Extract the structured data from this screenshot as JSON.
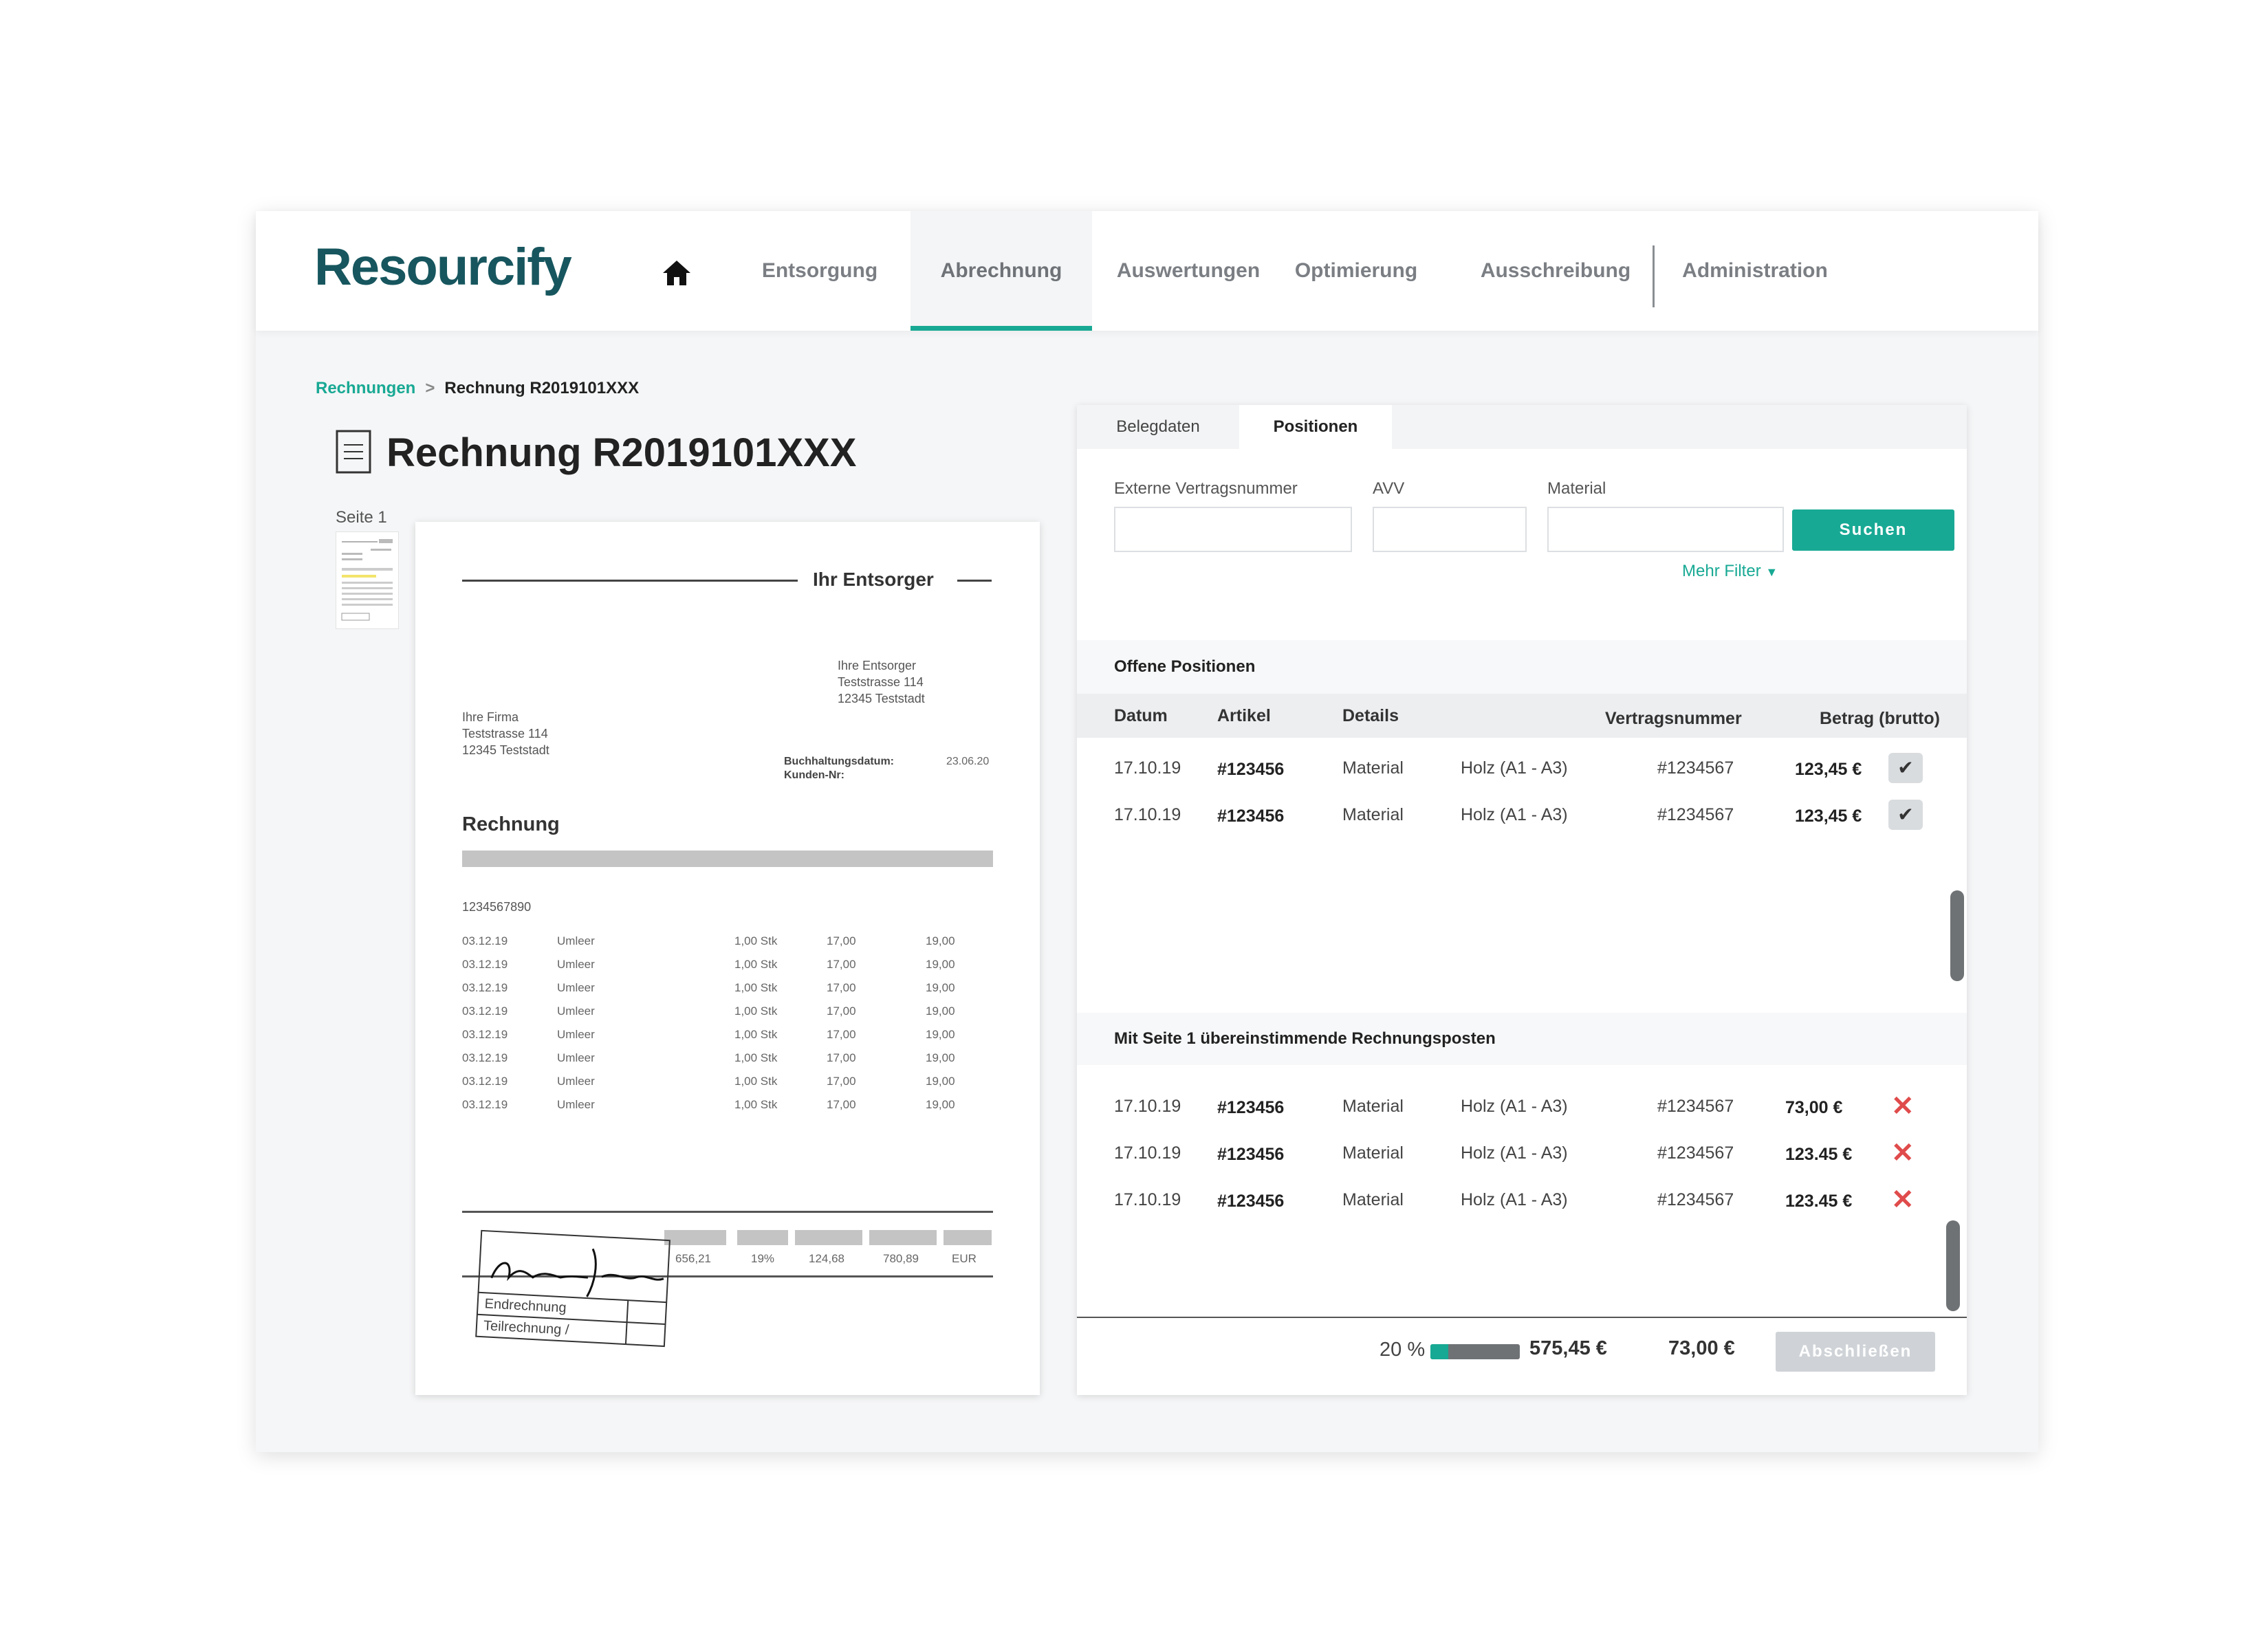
{
  "brand": {
    "logo": "Resourcify",
    "accent_color": "#18a994",
    "logo_color": "#17565e"
  },
  "nav": {
    "items": [
      "Entsorgung",
      "Abrechnung",
      "Auswertungen",
      "Optimierung",
      "Ausschreibung",
      "Administration"
    ],
    "active": "Abrechnung",
    "home_icon": "home-icon"
  },
  "breadcrumb": {
    "link": "Rechnungen",
    "separator": ">",
    "current": "Rechnung R2019101XXX"
  },
  "page": {
    "title": "Rechnung R2019101XXX",
    "page_label": "Seite 1"
  },
  "invoice": {
    "header": "Ihr Entsorger",
    "sender": [
      "Ihre Entsorger",
      "Teststrasse 114",
      "12345 Teststadt"
    ],
    "recipient": [
      "Ihre Firma",
      "Teststrasse 114",
      "12345 Teststadt"
    ],
    "meta": {
      "label1": "Buchhaltungsdatum:",
      "value1": "23.06.20",
      "label2": "Kunden-Nr:"
    },
    "title": "Rechnung",
    "number": "1234567890",
    "rows": [
      [
        "03.12.19",
        "Umleer",
        "1,00 Stk",
        "17,00",
        "19,00"
      ],
      [
        "03.12.19",
        "Umleer",
        "1,00 Stk",
        "17,00",
        "19,00"
      ],
      [
        "03.12.19",
        "Umleer",
        "1,00 Stk",
        "17,00",
        "19,00"
      ],
      [
        "03.12.19",
        "Umleer",
        "1,00 Stk",
        "17,00",
        "19,00"
      ],
      [
        "03.12.19",
        "Umleer",
        "1,00 Stk",
        "17,00",
        "19,00"
      ],
      [
        "03.12.19",
        "Umleer",
        "1,00 Stk",
        "17,00",
        "19,00"
      ],
      [
        "03.12.19",
        "Umleer",
        "1,00 Stk",
        "17,00",
        "19,00"
      ],
      [
        "03.12.19",
        "Umleer",
        "1,00 Stk",
        "17,00",
        "19,00"
      ]
    ],
    "totals": [
      "656,21",
      "19%",
      "124,68",
      "780,89",
      "EUR"
    ],
    "stamp": {
      "line1": "Endrechnung",
      "line2": "Teilrechnung /"
    }
  },
  "panel": {
    "tabs": [
      "Belegdaten",
      "Positionen"
    ],
    "active_tab": "Positionen",
    "filters": {
      "labels": [
        "Externe Vertragsnummer",
        "AVV",
        "Material"
      ],
      "values": [
        "",
        "",
        ""
      ],
      "search_button": "Suchen",
      "more_filters": "Mehr Filter"
    },
    "open_positions": {
      "title": "Offene Positionen",
      "columns": [
        "Datum",
        "Artikel",
        "Details",
        "Vertragsnummer",
        "Betrag (brutto)"
      ],
      "rows": [
        {
          "datum": "17.10.19",
          "artikel": "#123456",
          "details": "Material",
          "sub": "Holz (A1 - A3)",
          "vertrag": "#1234567",
          "betrag": "123,45 €",
          "action": "✔"
        },
        {
          "datum": "17.10.19",
          "artikel": "#123456",
          "details": "Material",
          "sub": "Holz (A1 - A3)",
          "vertrag": "#1234567",
          "betrag": "123,45 €",
          "action": "✔"
        }
      ]
    },
    "matched": {
      "title": "Mit Seite 1 übereinstimmende Rechnungsposten",
      "rows": [
        {
          "datum": "17.10.19",
          "artikel": "#123456",
          "details": "Material",
          "sub": "Holz (A1 - A3)",
          "vertrag": "#1234567",
          "betrag": "73,00 €",
          "action": "✕"
        },
        {
          "datum": "17.10.19",
          "artikel": "#123456",
          "details": "Material",
          "sub": "Holz (A1 - A3)",
          "vertrag": "#1234567",
          "betrag": "123.45 €",
          "action": "✕"
        },
        {
          "datum": "17.10.19",
          "artikel": "#123456",
          "details": "Material",
          "sub": "Holz (A1 - A3)",
          "vertrag": "#1234567",
          "betrag": "123.45 €",
          "action": "✕"
        }
      ]
    },
    "footer": {
      "percent": "20 %",
      "progress": 0.2,
      "total": "575,45 €",
      "matched_total": "73,00 €",
      "complete_button": "Abschließen"
    }
  }
}
